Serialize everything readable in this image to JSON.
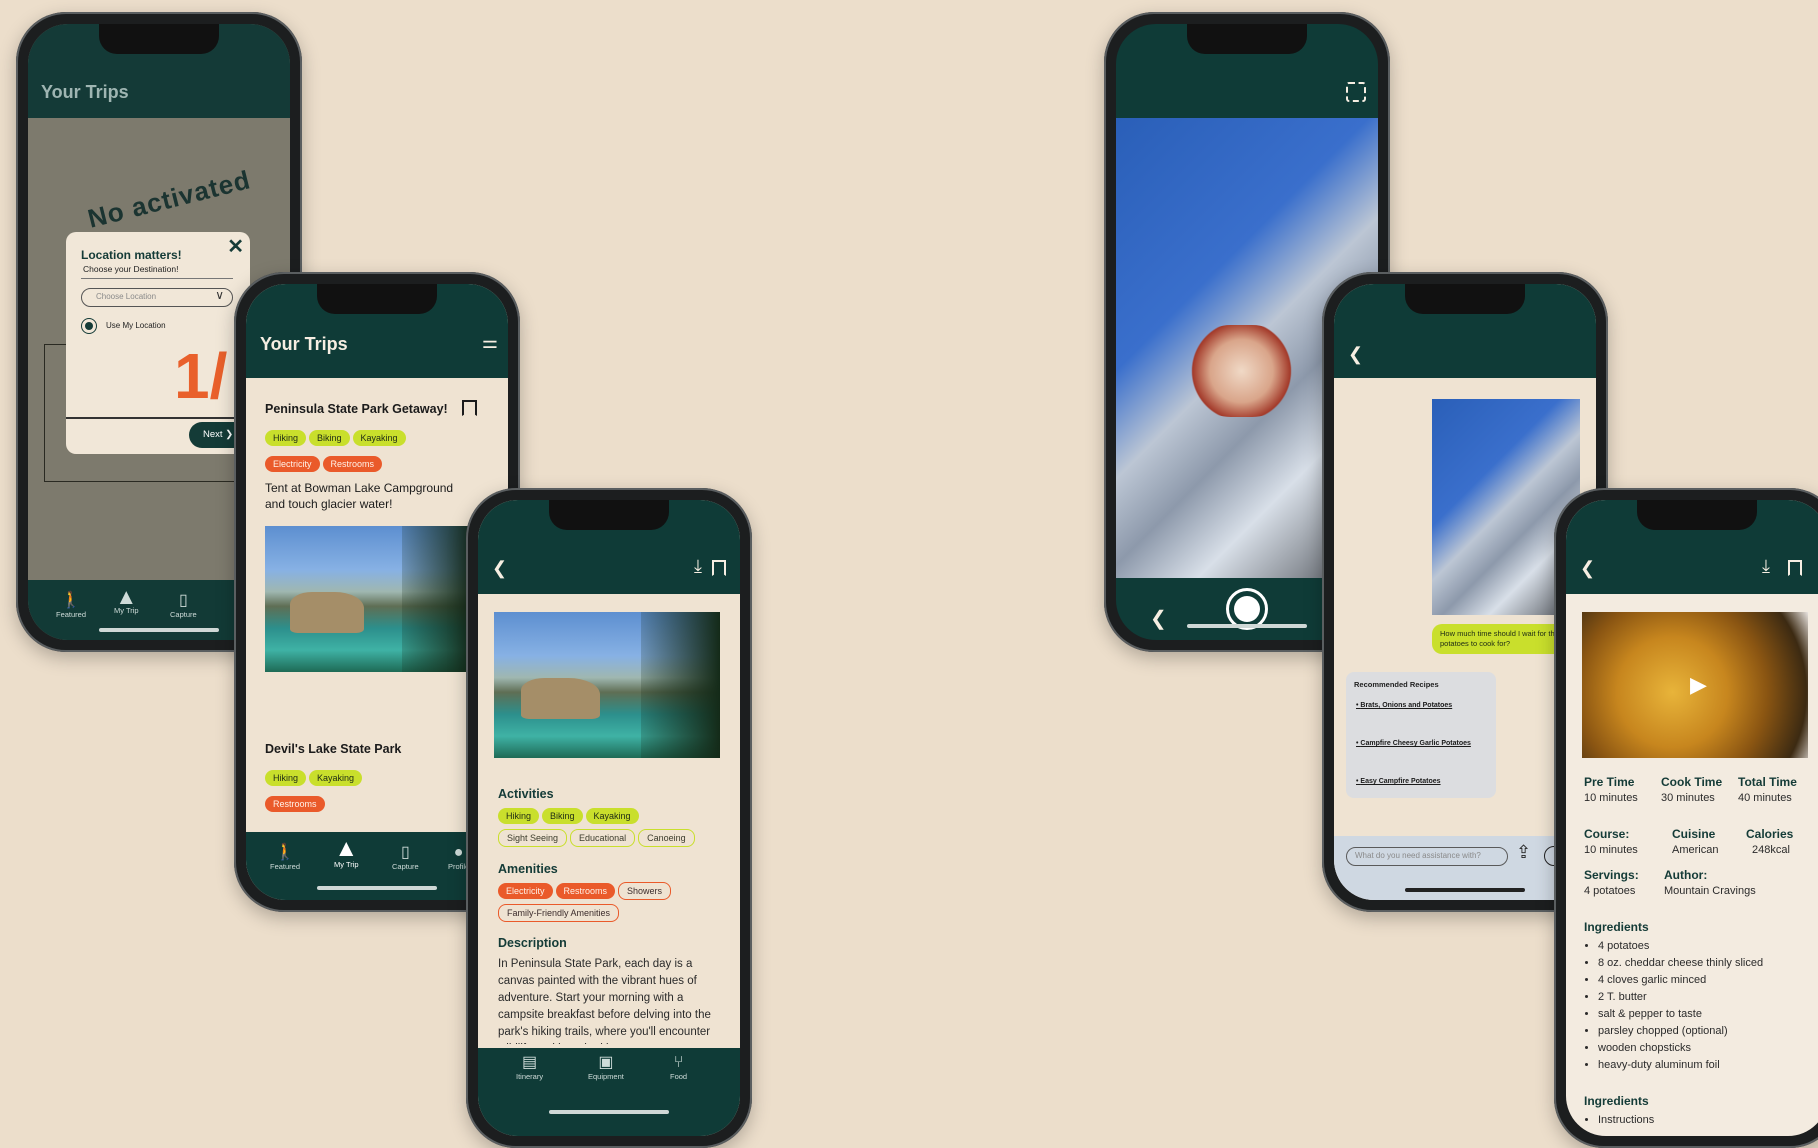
{
  "phone1": {
    "header_title": "Your Trips",
    "bg_text": "No activated",
    "bg_number": "1/",
    "modal": {
      "title": "Location matters!",
      "subtitle": "Choose your Destination!",
      "select_placeholder": "Choose Location",
      "radio_label": "Use My Location",
      "next_label": "Next"
    },
    "nav": [
      "Featured",
      "My Trip",
      "Capture"
    ]
  },
  "phone2": {
    "header_title": "Your Trips",
    "trips": [
      {
        "title": "Peninsula State Park Getaway!",
        "activity_tags": [
          "Hiking",
          "Biking",
          "Kayaking"
        ],
        "amenity_tags": [
          "Electricity",
          "Restrooms"
        ],
        "blurb": "Tent at Bowman Lake Campground and touch glacier water!"
      },
      {
        "title": "Devil's Lake State Park",
        "activity_tags": [
          "Hiking",
          "Kayaking"
        ],
        "amenity_tags": [
          "Restrooms"
        ]
      }
    ],
    "nav": [
      "Featured",
      "My Trip",
      "Capture",
      "Profile"
    ]
  },
  "phone3": {
    "activities_heading": "Activities",
    "activities_primary": [
      "Hiking",
      "Biking",
      "Kayaking"
    ],
    "activities_secondary": [
      "Sight Seeing",
      "Educational",
      "Canoeing"
    ],
    "amenities_heading": "Amenities",
    "amenities_primary": [
      "Electricity",
      "Restrooms"
    ],
    "amenities_secondary": [
      "Showers",
      "Family-Friendly Amenities"
    ],
    "description_heading": "Description",
    "description": "In Peninsula State Park, each day is a canvas painted with the vibrant hues of adventure. Start your morning with a campsite breakfast before delving into the park's hiking trails, where you'll encounter wildlife and breathtaking",
    "nav": [
      "Itinerary",
      "Equipment",
      "Food"
    ]
  },
  "phone5": {
    "user_message": "How much time should I wait for the potatoes to cook for?",
    "recipes_heading": "Recommended Recipes",
    "recipes": [
      "Brats, Onions and Potatoes",
      "Campfire Cheesy Garlic Potatoes",
      "Easy Campfire Potatoes"
    ],
    "input_placeholder": "What do you need assistance with?"
  },
  "phone6": {
    "stats": [
      {
        "label": "Pre Time",
        "value": "10 minutes"
      },
      {
        "label": "Cook Time",
        "value": "30 minutes"
      },
      {
        "label": "Total Time",
        "value": "40 minutes"
      }
    ],
    "meta": [
      {
        "label": "Course:",
        "value": "10 minutes"
      },
      {
        "label": "Cuisine",
        "value": "American"
      },
      {
        "label": "Calories",
        "value": "248kcal"
      }
    ],
    "servings_label": "Servings:",
    "servings_value": "4 potatoes",
    "author_label": "Author:",
    "author_value": "Mountain Cravings",
    "ingredients_heading": "Ingredients",
    "ingredients": [
      "4 potatoes",
      "8 oz. cheddar cheese thinly sliced",
      "4 cloves garlic minced",
      "2 T. butter",
      "salt & pepper to taste",
      "parsley chopped (optional)",
      "wooden chopsticks",
      "heavy-duty aluminum foil"
    ],
    "ingredients_heading_2": "Ingredients",
    "instructions_label": "Instructions"
  },
  "colors": {
    "background": "#ecdecb",
    "header_green": "#0f3b37",
    "tag_lime": "#c9df2c",
    "tag_orange": "#ea5a2a"
  }
}
